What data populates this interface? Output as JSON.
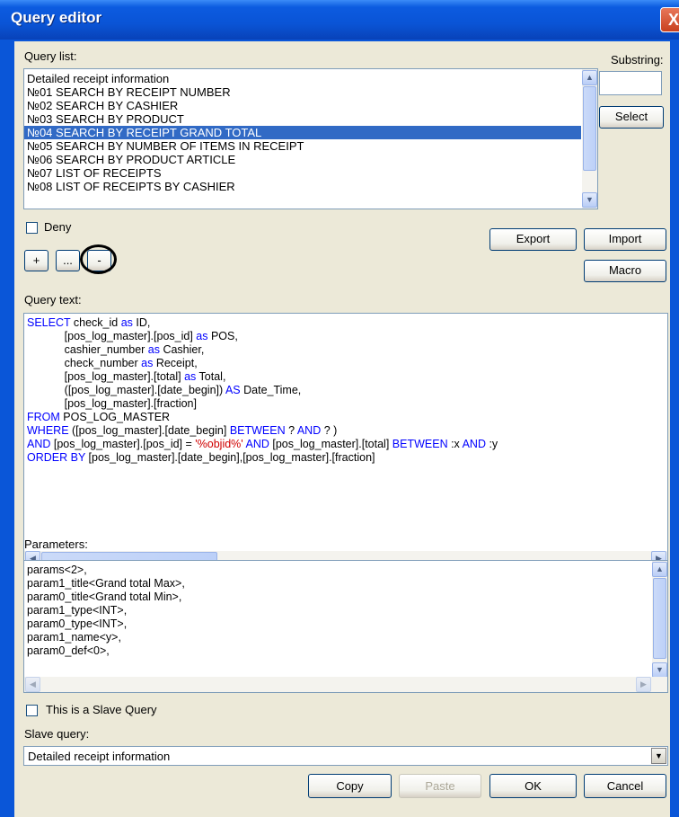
{
  "window": {
    "title": "Query editor",
    "close_glyph": "X"
  },
  "query_list": {
    "label": "Query list:",
    "items": [
      "Detailed receipt information",
      "№01 SEARCH BY RECEIPT NUMBER",
      "№02 SEARCH BY CASHIER",
      "№03 SEARCH BY PRODUCT",
      "№04 SEARCH BY RECEIPT GRAND TOTAL",
      "№05 SEARCH BY NUMBER OF ITEMS IN RECEIPT",
      "№06 SEARCH BY PRODUCT ARTICLE",
      "№07 LIST OF RECEIPTS",
      "№08 LIST OF RECEIPTS BY CASHIER"
    ],
    "selected_item": "№04 SEARCH BY RECEIPT GRAND TOTAL"
  },
  "substring": {
    "label": "Substring:",
    "value": "",
    "select_label": "Select"
  },
  "deny": {
    "label": "Deny",
    "checked": false
  },
  "toolbar": {
    "add_label": "+",
    "more_label": "...",
    "remove_label": "-",
    "export_label": "Export",
    "import_label": "Import",
    "macro_label": "Macro"
  },
  "query_text": {
    "label": "Query text:",
    "lines": [
      [
        {
          "t": "SELECT",
          "c": "kw"
        },
        {
          "t": " check_id "
        },
        {
          "t": "as",
          "c": "kw"
        },
        {
          "t": " ID,"
        }
      ],
      [
        {
          "t": "            [pos_log_master].[pos_id] "
        },
        {
          "t": "as",
          "c": "kw"
        },
        {
          "t": " POS,"
        }
      ],
      [
        {
          "t": "            cashier_number "
        },
        {
          "t": "as",
          "c": "kw"
        },
        {
          "t": " Cashier,"
        }
      ],
      [
        {
          "t": "            check_number "
        },
        {
          "t": "as",
          "c": "kw"
        },
        {
          "t": " Receipt,"
        }
      ],
      [
        {
          "t": "            [pos_log_master].[total] "
        },
        {
          "t": "as",
          "c": "kw"
        },
        {
          "t": " Total,"
        }
      ],
      [
        {
          "t": "            ([pos_log_master].[date_begin]) "
        },
        {
          "t": "AS",
          "c": "kw"
        },
        {
          "t": " Date_Time,"
        }
      ],
      [
        {
          "t": "            [pos_log_master].[fraction]"
        }
      ],
      [
        {
          "t": "FROM",
          "c": "kw"
        },
        {
          "t": " POS_LOG_MASTER"
        }
      ],
      [
        {
          "t": "WHERE",
          "c": "kw"
        },
        {
          "t": " ([pos_log_master].[date_begin] "
        },
        {
          "t": "BETWEEN",
          "c": "kw"
        },
        {
          "t": " ? "
        },
        {
          "t": "AND",
          "c": "kw"
        },
        {
          "t": " ? )"
        }
      ],
      [
        {
          "t": "AND",
          "c": "kw"
        },
        {
          "t": " [pos_log_master].[pos_id] = "
        },
        {
          "t": "'%objid%'",
          "c": "str"
        },
        {
          "t": " "
        },
        {
          "t": "AND",
          "c": "kw"
        },
        {
          "t": " [pos_log_master].[total] "
        },
        {
          "t": "BETWEEN",
          "c": "kw"
        },
        {
          "t": " :x "
        },
        {
          "t": "AND",
          "c": "kw"
        },
        {
          "t": " :y"
        }
      ],
      [
        {
          "t": "ORDER BY",
          "c": "kw"
        },
        {
          "t": " [pos_log_master].[date_begin],[pos_log_master].[fraction]"
        }
      ]
    ]
  },
  "parameters": {
    "label": "Parameters:",
    "lines": [
      "params<2>,",
      "param1_title<Grand total Max>,",
      "param0_title<Grand total Min>,",
      "param1_type<INT>,",
      "param0_type<INT>,",
      "param1_name<y>,",
      "param0_def<0>,"
    ]
  },
  "slave": {
    "checkbox_label": "This is a Slave Query",
    "checked": false,
    "label": "Slave query:",
    "selected": "Detailed receipt information"
  },
  "footer": {
    "copy_label": "Copy",
    "paste_label": "Paste",
    "ok_label": "OK",
    "cancel_label": "Cancel"
  }
}
